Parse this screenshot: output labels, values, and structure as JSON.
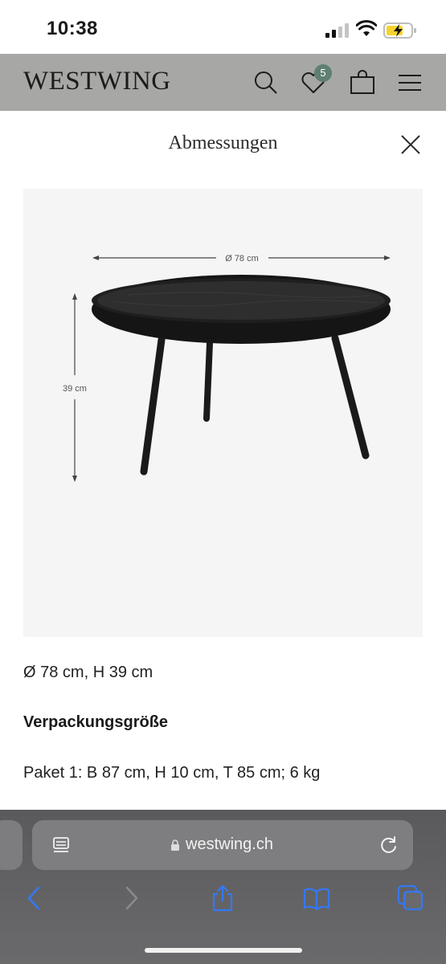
{
  "status_bar": {
    "time": "10:38"
  },
  "header": {
    "brand": "WESTWING",
    "wishlist_count": "5",
    "icons": [
      "search-icon",
      "heart-icon",
      "bag-icon",
      "menu-icon"
    ]
  },
  "modal": {
    "title": "Abmessungen",
    "close_icon": "close-icon"
  },
  "figure": {
    "diameter_label": "Ø 78 cm",
    "height_label": "39 cm"
  },
  "details": {
    "dimensions": "Ø 78 cm, H 39 cm",
    "package_heading": "Verpackungsgröße",
    "package_info": "Paket 1: B 87 cm, H 10 cm, T 85 cm; 6 kg"
  },
  "browser": {
    "url": "westwing.ch",
    "colors": {
      "accent": "#3478f6"
    }
  }
}
